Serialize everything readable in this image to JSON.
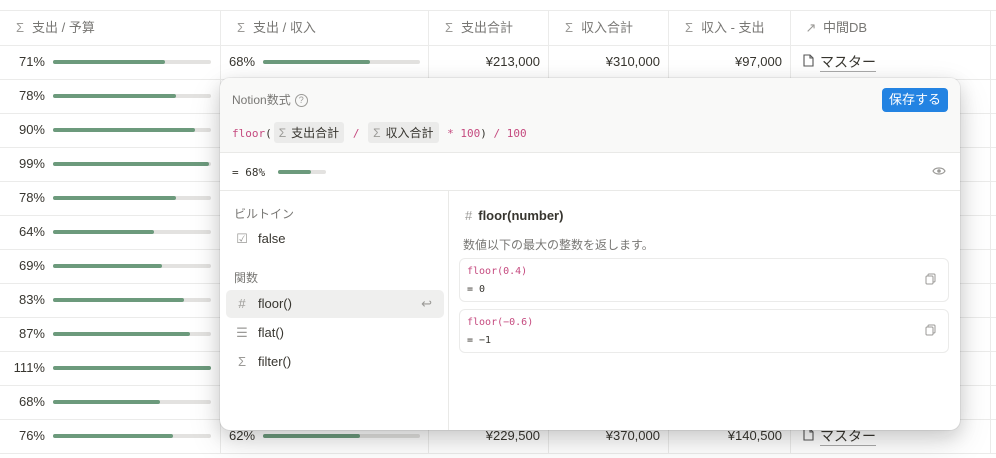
{
  "table": {
    "columns": [
      {
        "icon": "Σ",
        "label": "支出 / 予算"
      },
      {
        "icon": "Σ",
        "label": "支出 / 収入"
      },
      {
        "icon": "Σ",
        "label": "支出合計"
      },
      {
        "icon": "Σ",
        "label": "収入合計"
      },
      {
        "icon": "Σ",
        "label": "収入 - 支出"
      },
      {
        "icon": "↗",
        "label": "中間DB"
      }
    ],
    "rows": [
      {
        "budget_pct": "71%",
        "budget_fill": 0.71,
        "income_pct": "68%",
        "income_fill": 0.68,
        "expense": "¥213,000",
        "income": "¥310,000",
        "diff": "¥97,000",
        "relation": "マスター"
      },
      {
        "budget_pct": "78%",
        "budget_fill": 0.78
      },
      {
        "budget_pct": "90%",
        "budget_fill": 0.9
      },
      {
        "budget_pct": "99%",
        "budget_fill": 0.99
      },
      {
        "budget_pct": "78%",
        "budget_fill": 0.78
      },
      {
        "budget_pct": "64%",
        "budget_fill": 0.64
      },
      {
        "budget_pct": "69%",
        "budget_fill": 0.69
      },
      {
        "budget_pct": "83%",
        "budget_fill": 0.83
      },
      {
        "budget_pct": "87%",
        "budget_fill": 0.87
      },
      {
        "budget_pct": "111%",
        "budget_fill": 1.0
      },
      {
        "budget_pct": "68%",
        "budget_fill": 0.68
      },
      {
        "budget_pct": "76%",
        "budget_fill": 0.76,
        "income_pct": "62%",
        "income_fill": 0.62,
        "expense": "¥229,500",
        "income": "¥370,000",
        "diff": "¥140,500",
        "relation": "マスター"
      }
    ]
  },
  "popup": {
    "title": "Notion数式",
    "help_icon": "?",
    "save_label": "保存する",
    "formula": {
      "fn": "floor",
      "open": "(",
      "prop1_icon": "Σ",
      "prop1": "支出合計",
      "op1": "/",
      "prop2_icon": "Σ",
      "prop2": "収入合計",
      "op2": "*",
      "n1": "100",
      "close": ")",
      "op3": "/",
      "n2": "100"
    },
    "result": {
      "text": "= 68%",
      "fill": 0.68
    },
    "sections": {
      "builtin": "ビルトイン",
      "functions": "関数"
    },
    "builtin_items": [
      {
        "icon": "☑",
        "label": "false"
      }
    ],
    "function_items": [
      {
        "icon": "#",
        "label": "floor()",
        "selected": true
      },
      {
        "icon": "☰",
        "label": "flat()"
      },
      {
        "icon": "Σ",
        "label": "filter()"
      }
    ],
    "detail": {
      "title_icon": "#",
      "title": "floor(number)",
      "description": "数値以下の最大の整数を返します。",
      "examples": [
        {
          "code": "floor(0.4)",
          "result": "= 0"
        },
        {
          "code": "floor(−0.6)",
          "result": "= −1"
        }
      ]
    }
  },
  "colors": {
    "accent": "#2383e2",
    "bar_fill": "#6c9a7c",
    "bar_track": "#e3e2e0",
    "code_fn": "#c54a7f"
  }
}
